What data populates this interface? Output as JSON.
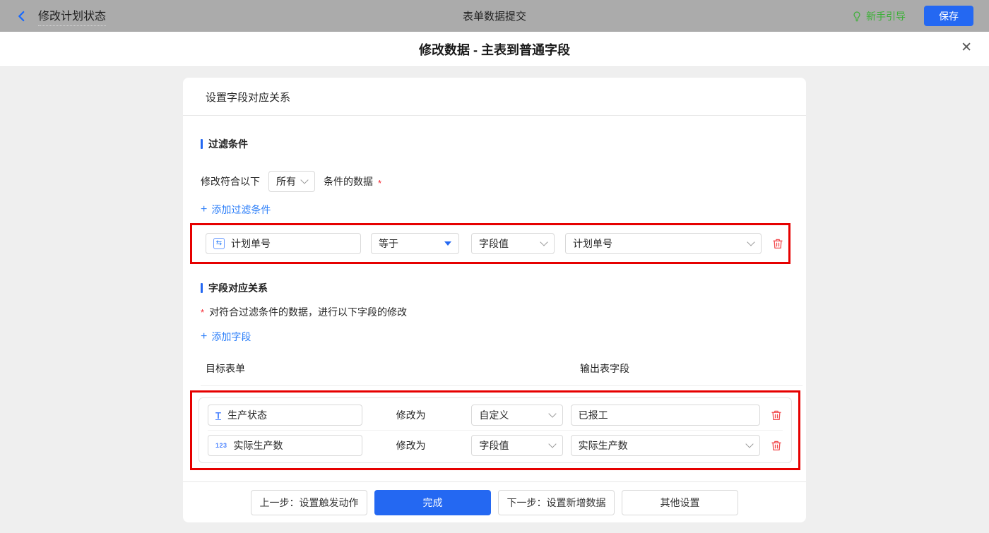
{
  "topbar": {
    "back_label": "修改计划状态",
    "center_title": "表单数据提交",
    "guide_label": "新手引导",
    "save_label": "保存"
  },
  "modal": {
    "title": "修改数据 - 主表到普通字段"
  },
  "icons": {
    "close_glyph": "✕",
    "plus_glyph": "+",
    "serial_glyph": "⇆",
    "text_glyph": "T",
    "number_glyph": "123"
  },
  "panel": {
    "header": "设置字段对应关系",
    "filter": {
      "title": "过滤条件",
      "sentence_prefix": "修改符合以下",
      "match_mode": "所有",
      "sentence_suffix": "条件的数据",
      "required_mark": "*",
      "add_link": "添加过滤条件",
      "condition": {
        "field": "计划单号",
        "operator": "等于",
        "value_type": "字段值",
        "value": "计划单号"
      }
    },
    "mapping": {
      "title": "字段对应关系",
      "required_mark": "*",
      "description": "对符合过滤条件的数据，进行以下字段的修改",
      "add_link": "添加字段",
      "columns": {
        "target": "目标表单",
        "output": "输出表字段"
      },
      "rows": [
        {
          "field": "生产状态",
          "verb": "修改为",
          "mode": "自定义",
          "value": "已报工"
        },
        {
          "field": "实际生产数",
          "verb": "修改为",
          "mode": "字段值",
          "value": "实际生产数"
        }
      ]
    },
    "footer": {
      "prev_label": "上一步：设置触发动作",
      "done_label": "完成",
      "next_label": "下一步：设置新增数据",
      "other_label": "其他设置"
    }
  },
  "colors": {
    "accent_blue": "#2468f2",
    "link_blue": "#2d7ff9",
    "guide_green": "#3cb037",
    "trash_red": "#f2484b",
    "annotation_red": "#e60000",
    "topbar_gray": "#ababab"
  }
}
